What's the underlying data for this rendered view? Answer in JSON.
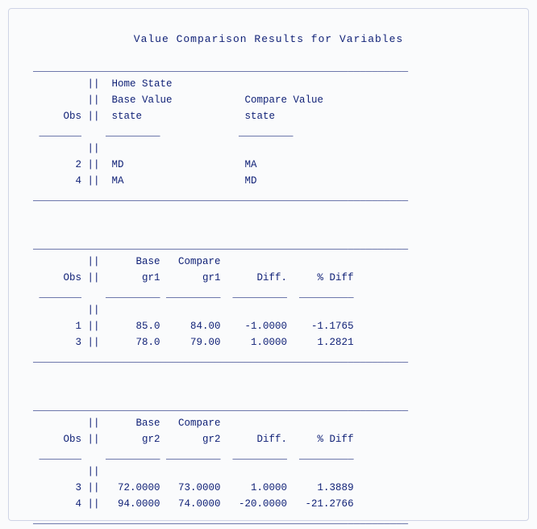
{
  "title": "Value Comparison Results for Variables",
  "section1": {
    "var_label": "Home State",
    "base_header": "Base Value",
    "compare_header": "Compare Value",
    "obs_header": "Obs",
    "base_sub": "state",
    "compare_sub": "state",
    "rows": [
      {
        "obs": "2",
        "base": "MD",
        "compare": "MA"
      },
      {
        "obs": "4",
        "base": "MA",
        "compare": "MD"
      }
    ]
  },
  "section2": {
    "obs_header": "Obs",
    "base_header": "Base",
    "compare_header": "Compare",
    "base_sub": "gr1",
    "compare_sub": "gr1",
    "diff_header": "Diff.",
    "pctdiff_header": "% Diff",
    "rows": [
      {
        "obs": "1",
        "base": "85.0",
        "compare": "84.00",
        "diff": "-1.0000",
        "pct": "-1.1765"
      },
      {
        "obs": "3",
        "base": "78.0",
        "compare": "79.00",
        "diff": "1.0000",
        "pct": "1.2821"
      }
    ]
  },
  "section3": {
    "obs_header": "Obs",
    "base_header": "Base",
    "compare_header": "Compare",
    "base_sub": "gr2",
    "compare_sub": "gr2",
    "diff_header": "Diff.",
    "pctdiff_header": "% Diff",
    "rows": [
      {
        "obs": "3",
        "base": "72.0000",
        "compare": "73.0000",
        "diff": "1.0000",
        "pct": "1.3889"
      },
      {
        "obs": "4",
        "base": "94.0000",
        "compare": "74.0000",
        "diff": "-20.0000",
        "pct": "-21.2766"
      }
    ]
  }
}
